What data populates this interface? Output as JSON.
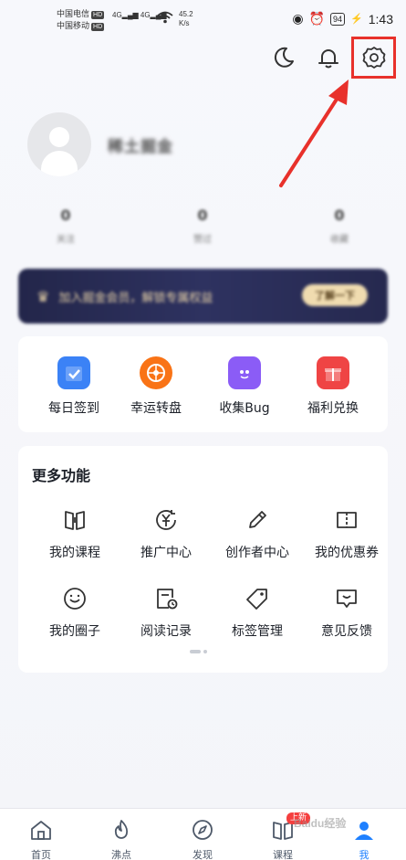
{
  "status_bar": {
    "carrier1": "中国电信",
    "carrier2": "中国移动",
    "hd": "HD",
    "signal": "4G",
    "net_speed": "45.2",
    "net_unit": "K/s",
    "battery": "94",
    "time": "1:43"
  },
  "profile": {
    "nickname": "稀土掘金"
  },
  "stats": [
    {
      "value": "0",
      "label": "关注"
    },
    {
      "value": "0",
      "label": "赞过"
    },
    {
      "value": "0",
      "label": "收藏"
    }
  ],
  "vip": {
    "text": "加入掘金会员，解锁专属权益",
    "button": "了解一下"
  },
  "quick_actions": [
    {
      "label": "每日签到",
      "color": "#3b82f6",
      "icon": "checkin-calendar-icon"
    },
    {
      "label": "幸运转盘",
      "color": "#f97316",
      "icon": "lucky-wheel-icon"
    },
    {
      "label": "收集Bug",
      "color": "#8b5cf6",
      "icon": "bug-monster-icon"
    },
    {
      "label": "福利兑换",
      "color": "#ef4444",
      "icon": "gift-icon"
    }
  ],
  "more": {
    "title": "更多功能",
    "items": [
      {
        "label": "我的课程",
        "icon": "book-icon"
      },
      {
        "label": "推广中心",
        "icon": "yen-coin-icon"
      },
      {
        "label": "创作者中心",
        "icon": "pencil-icon"
      },
      {
        "label": "我的优惠券",
        "icon": "coupon-icon"
      },
      {
        "label": "我的圈子",
        "icon": "smile-circle-icon"
      },
      {
        "label": "阅读记录",
        "icon": "reading-history-icon"
      },
      {
        "label": "标签管理",
        "icon": "tag-icon"
      },
      {
        "label": "意见反馈",
        "icon": "feedback-icon"
      }
    ]
  },
  "bottom_nav": [
    {
      "label": "首页",
      "icon": "home-icon"
    },
    {
      "label": "沸点",
      "icon": "flame-icon"
    },
    {
      "label": "发现",
      "icon": "compass-icon"
    },
    {
      "label": "课程",
      "icon": "course-book-icon",
      "badge": "上新"
    },
    {
      "label": "我",
      "icon": "me-icon",
      "active": true
    }
  ],
  "watermark": "Baidu经验",
  "colors": {
    "accent": "#1e80ff",
    "highlight": "#e8312b",
    "banner_bg": "#2e3260"
  }
}
